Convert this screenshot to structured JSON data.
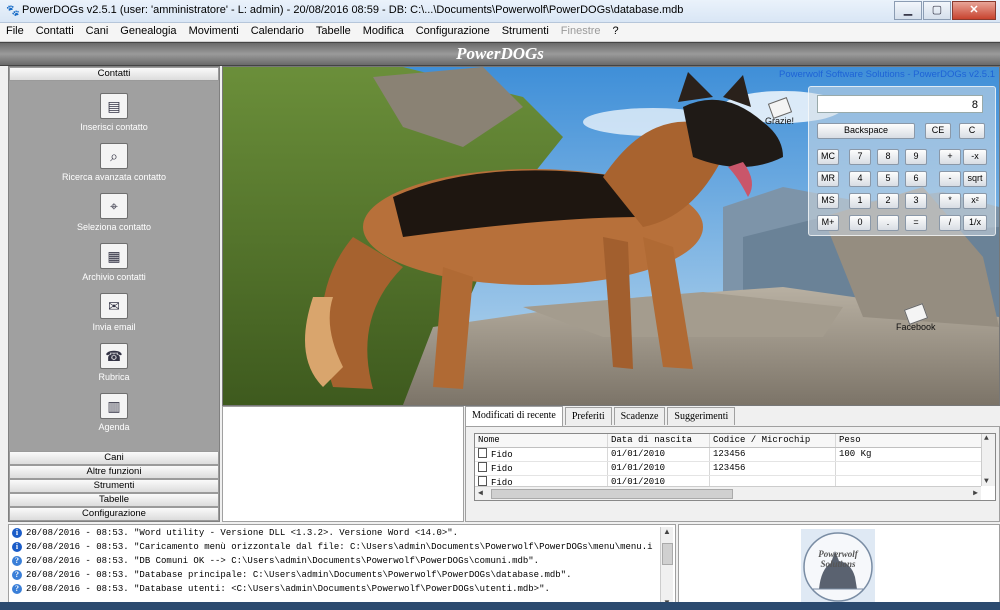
{
  "window": {
    "title": "PowerDOGs v2.5.1  (user: 'amministratore'  - L: admin) - 20/08/2016 08:59 - DB: C:\\...\\Documents\\Powerwolf\\PowerDOGs\\database.mdb",
    "icon": "paw-icon",
    "buttons": [
      "minimize-icon",
      "maximize-icon",
      "close-icon"
    ]
  },
  "menu": {
    "items": [
      "File",
      "Contatti",
      "Cani",
      "Genealogia",
      "Movimenti",
      "Calendario",
      "Tabelle",
      "Modifica",
      "Configurazione",
      "Strumenti",
      "Finestre",
      "?"
    ],
    "disabled": [
      "Finestre"
    ]
  },
  "banner": {
    "title": "PowerDOGs"
  },
  "sidebar": {
    "open_section": "Contatti",
    "items": [
      {
        "label": "Inserisci contatto",
        "icon": "contact-card-icon"
      },
      {
        "label": "Ricerca avanzata contatto",
        "icon": "search-contact-icon"
      },
      {
        "label": "Seleziona contatto",
        "icon": "select-contact-icon"
      },
      {
        "label": "Archivio contatti",
        "icon": "contacts-archive-icon"
      },
      {
        "label": "Invia email",
        "icon": "email-icon"
      },
      {
        "label": "Rubrica",
        "icon": "address-book-icon"
      },
      {
        "label": "Agenda",
        "icon": "agenda-icon"
      }
    ],
    "sections": [
      "Cani",
      "Altre funzioni",
      "Strumenti",
      "Tabelle",
      "Configurazione"
    ]
  },
  "desktop": {
    "brand": "Powerwolf Software Solutions - PowerDOGs v2.5.1",
    "thanks_label": "Grazie!",
    "facebook_label": "Facebook"
  },
  "calculator": {
    "display": "8",
    "top": [
      "Backspace",
      "CE",
      "C"
    ],
    "rows": [
      [
        "MC",
        "7",
        "8",
        "9",
        "+",
        "-x"
      ],
      [
        "MR",
        "4",
        "5",
        "6",
        "-",
        "sqrt"
      ],
      [
        "MS",
        "1",
        "2",
        "3",
        "*",
        "x²"
      ],
      [
        "M+",
        "0",
        ".",
        "=",
        "/",
        "1/x"
      ]
    ]
  },
  "tabs": {
    "items": [
      "Modificati di recente",
      "Preferiti",
      "Scadenze",
      "Suggerimenti"
    ],
    "active": "Modificati di recente"
  },
  "table": {
    "columns": [
      "Nome",
      "Data di nascita",
      "Codice / Microchip",
      "Peso"
    ],
    "rows": [
      [
        "Fido",
        "01/01/2010",
        "123456",
        "100 Kg"
      ],
      [
        "Fido",
        "01/01/2010",
        "123456",
        ""
      ],
      [
        "Fido",
        "01/01/2010",
        "",
        ""
      ]
    ]
  },
  "log": {
    "lines": [
      {
        "icon": "info-icon",
        "text": "20/08/2016 - 08:53. \"Word utility - Versione DLL <1.3.2>. Versione Word <14.0>\"."
      },
      {
        "icon": "info-icon",
        "text": "20/08/2016 - 08:53. \"Caricamento menù orizzontale dal file: C:\\Users\\admin\\Documents\\Powerwolf\\PowerDOGs\\menu\\menu.i"
      },
      {
        "icon": "question-icon",
        "text": "20/08/2016 - 08:53. \"DB Comuni OK --> C:\\Users\\admin\\Documents\\Powerwolf\\PowerDOGs\\comuni.mdb\"."
      },
      {
        "icon": "question-icon",
        "text": "20/08/2016 - 08:53. \"Database principale: C:\\Users\\admin\\Documents\\Powerwolf\\PowerDOGs\\database.mdb\"."
      },
      {
        "icon": "question-icon",
        "text": "20/08/2016 - 08:53. \"Database utenti: <C:\\Users\\admin\\Documents\\Powerwolf\\PowerDOGs\\utenti.mdb>\"."
      }
    ]
  },
  "logo": {
    "text": "Powerwolf Solutions"
  },
  "colors": {
    "brand_blue": "#1e63d6",
    "sidebar_gray": "#a0a0a0",
    "banner_gray": "#808080"
  }
}
